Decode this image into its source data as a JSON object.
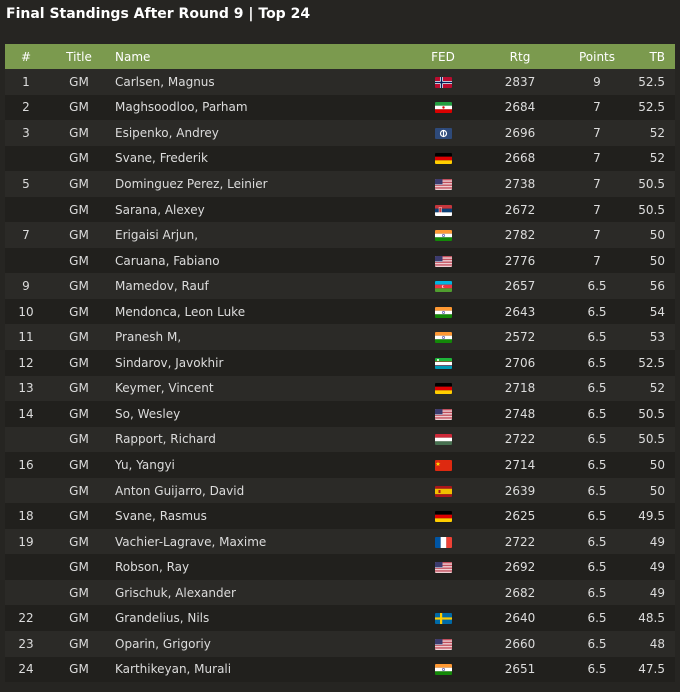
{
  "page_title": "Final Standings After Round 9 | Top 24",
  "columns": [
    "#",
    "Title",
    "Name",
    "FED",
    "Rtg",
    "Points",
    "TB"
  ],
  "rows": [
    {
      "rank": "1",
      "title": "GM",
      "name": "Carlsen, Magnus",
      "fed": "norway",
      "rtg": "2837",
      "pts": "9",
      "tb": "52.5"
    },
    {
      "rank": "2",
      "title": "GM",
      "name": "Maghsoodloo, Parham",
      "fed": "iran",
      "rtg": "2684",
      "pts": "7",
      "tb": "52.5"
    },
    {
      "rank": "3",
      "title": "GM",
      "name": "Esipenko, Andrey",
      "fed": "fide",
      "rtg": "2696",
      "pts": "7",
      "tb": "52"
    },
    {
      "rank": "",
      "title": "GM",
      "name": "Svane, Frederik",
      "fed": "germany",
      "rtg": "2668",
      "pts": "7",
      "tb": "52"
    },
    {
      "rank": "5",
      "title": "GM",
      "name": "Dominguez Perez, Leinier",
      "fed": "usa",
      "rtg": "2738",
      "pts": "7",
      "tb": "50.5"
    },
    {
      "rank": "",
      "title": "GM",
      "name": "Sarana, Alexey",
      "fed": "serbia",
      "rtg": "2672",
      "pts": "7",
      "tb": "50.5"
    },
    {
      "rank": "7",
      "title": "GM",
      "name": "Erigaisi Arjun,",
      "fed": "india",
      "rtg": "2782",
      "pts": "7",
      "tb": "50"
    },
    {
      "rank": "",
      "title": "GM",
      "name": "Caruana, Fabiano",
      "fed": "usa",
      "rtg": "2776",
      "pts": "7",
      "tb": "50"
    },
    {
      "rank": "9",
      "title": "GM",
      "name": "Mamedov, Rauf",
      "fed": "azerbaijan",
      "rtg": "2657",
      "pts": "6.5",
      "tb": "56"
    },
    {
      "rank": "10",
      "title": "GM",
      "name": "Mendonca, Leon Luke",
      "fed": "india",
      "rtg": "2643",
      "pts": "6.5",
      "tb": "54"
    },
    {
      "rank": "11",
      "title": "GM",
      "name": "Pranesh M,",
      "fed": "india",
      "rtg": "2572",
      "pts": "6.5",
      "tb": "53"
    },
    {
      "rank": "12",
      "title": "GM",
      "name": "Sindarov, Javokhir",
      "fed": "uzbekistan",
      "rtg": "2706",
      "pts": "6.5",
      "tb": "52.5"
    },
    {
      "rank": "13",
      "title": "GM",
      "name": "Keymer, Vincent",
      "fed": "germany",
      "rtg": "2718",
      "pts": "6.5",
      "tb": "52"
    },
    {
      "rank": "14",
      "title": "GM",
      "name": "So, Wesley",
      "fed": "usa",
      "rtg": "2748",
      "pts": "6.5",
      "tb": "50.5"
    },
    {
      "rank": "",
      "title": "GM",
      "name": "Rapport, Richard",
      "fed": "hungary",
      "rtg": "2722",
      "pts": "6.5",
      "tb": "50.5"
    },
    {
      "rank": "16",
      "title": "GM",
      "name": "Yu, Yangyi",
      "fed": "china",
      "rtg": "2714",
      "pts": "6.5",
      "tb": "50"
    },
    {
      "rank": "",
      "title": "GM",
      "name": "Anton Guijarro, David",
      "fed": "spain",
      "rtg": "2639",
      "pts": "6.5",
      "tb": "50"
    },
    {
      "rank": "18",
      "title": "GM",
      "name": "Svane, Rasmus",
      "fed": "germany",
      "rtg": "2625",
      "pts": "6.5",
      "tb": "49.5"
    },
    {
      "rank": "19",
      "title": "GM",
      "name": "Vachier-Lagrave, Maxime",
      "fed": "france",
      "rtg": "2722",
      "pts": "6.5",
      "tb": "49"
    },
    {
      "rank": "",
      "title": "GM",
      "name": "Robson, Ray",
      "fed": "usa",
      "rtg": "2692",
      "pts": "6.5",
      "tb": "49"
    },
    {
      "rank": "",
      "title": "GM",
      "name": "Grischuk, Alexander",
      "fed": "none",
      "rtg": "2682",
      "pts": "6.5",
      "tb": "49"
    },
    {
      "rank": "22",
      "title": "GM",
      "name": "Grandelius, Nils",
      "fed": "sweden",
      "rtg": "2640",
      "pts": "6.5",
      "tb": "48.5"
    },
    {
      "rank": "23",
      "title": "GM",
      "name": "Oparin, Grigoriy",
      "fed": "usa",
      "rtg": "2660",
      "pts": "6.5",
      "tb": "48"
    },
    {
      "rank": "24",
      "title": "GM",
      "name": "Karthikeyan, Murali",
      "fed": "india",
      "rtg": "2651",
      "pts": "6.5",
      "tb": "47.5"
    }
  ],
  "colors": {
    "background": "#262522",
    "header": "#7b9a4e",
    "row_odd": "#2b2a27",
    "row_even": "#21201d",
    "text": "#dcdcdc"
  }
}
